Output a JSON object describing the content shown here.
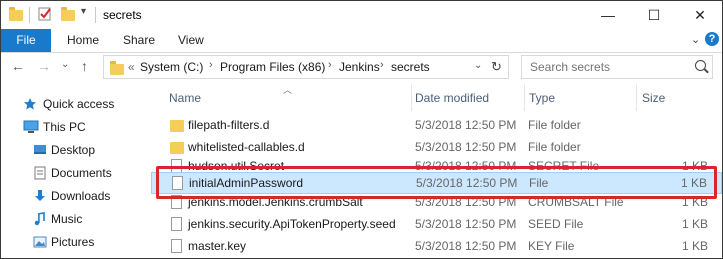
{
  "window": {
    "title": "secrets",
    "controls": {
      "minimize": "—",
      "maximize": "☐",
      "close": "✕"
    }
  },
  "ribbon": {
    "tabs": [
      {
        "label": "File"
      },
      {
        "label": "Home"
      },
      {
        "label": "Share"
      },
      {
        "label": "View"
      }
    ],
    "help": "?"
  },
  "address": {
    "prefix": "«",
    "crumbs": [
      "System (C:)",
      "Program Files (x86)",
      "Jenkins",
      "secrets"
    ]
  },
  "search": {
    "placeholder": "Search secrets"
  },
  "nav_pane": {
    "items": [
      {
        "label": "Quick access",
        "icon": "star-icon"
      },
      {
        "label": "This PC",
        "icon": "computer-icon"
      },
      {
        "label": "Desktop",
        "icon": "desktop-icon"
      },
      {
        "label": "Documents",
        "icon": "documents-icon"
      },
      {
        "label": "Downloads",
        "icon": "downloads-icon"
      },
      {
        "label": "Music",
        "icon": "music-icon"
      },
      {
        "label": "Pictures",
        "icon": "pictures-icon"
      }
    ]
  },
  "columns": {
    "name": "Name",
    "date": "Date modified",
    "type": "Type",
    "size": "Size"
  },
  "files": [
    {
      "name": "filepath-filters.d",
      "date": "5/3/2018 12:50 PM",
      "type": "File folder",
      "size": "",
      "kind": "folder"
    },
    {
      "name": "whitelisted-callables.d",
      "date": "5/3/2018 12:50 PM",
      "type": "File folder",
      "size": "",
      "kind": "folder"
    },
    {
      "name": "hudson.util.Secret",
      "date": "5/3/2018 12:50 PM",
      "type": "SECRET File",
      "size": "1 KB",
      "kind": "file"
    },
    {
      "name": "initialAdminPassword",
      "date": "5/3/2018 12:50 PM",
      "type": "File",
      "size": "1 KB",
      "kind": "file",
      "selected": true
    },
    {
      "name": "jenkins.model.Jenkins.crumbSalt",
      "date": "5/3/2018 12:50 PM",
      "type": "CRUMBSALT File",
      "size": "1 KB",
      "kind": "file"
    },
    {
      "name": "jenkins.security.ApiTokenProperty.seed",
      "date": "5/3/2018 12:50 PM",
      "type": "SEED File",
      "size": "1 KB",
      "kind": "file"
    },
    {
      "name": "master.key",
      "date": "5/3/2018 12:50 PM",
      "type": "KEY File",
      "size": "1 KB",
      "kind": "file"
    }
  ],
  "colors": {
    "accent": "#1979ca",
    "selection": "#cce8ff",
    "highlight_box": "#d9252e"
  }
}
